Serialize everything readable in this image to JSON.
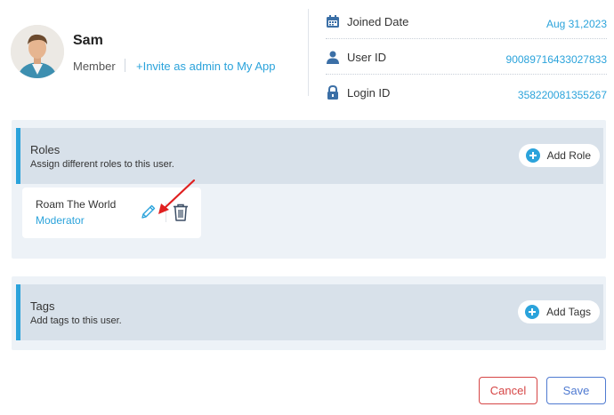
{
  "profile": {
    "name": "Sam",
    "role": "Member",
    "invite_link": "+Invite as admin to My App"
  },
  "details": [
    {
      "icon": "calendar-icon",
      "label": "Joined Date",
      "value": "Aug 31,2023"
    },
    {
      "icon": "user-icon",
      "label": "User ID",
      "value": "90089716433027833"
    },
    {
      "icon": "lock-icon",
      "label": "Login ID",
      "value": "358220081355267"
    }
  ],
  "roles": {
    "title": "Roles",
    "subtitle": "Assign different roles to this user.",
    "add_label": "Add Role",
    "items": [
      {
        "name": "Roam The World",
        "role": "Moderator"
      }
    ]
  },
  "tags": {
    "title": "Tags",
    "subtitle": "Add tags to this user.",
    "add_label": "Add Tags"
  },
  "footer": {
    "cancel_label": "Cancel",
    "save_label": "Save"
  },
  "colors": {
    "accent": "#2ba3db",
    "panel_bg": "#edf2f7",
    "panel_head_bg": "#d8e1ea",
    "cancel": "#d64545",
    "save": "#4f7ad1",
    "annotation_arrow": "#e02020"
  }
}
